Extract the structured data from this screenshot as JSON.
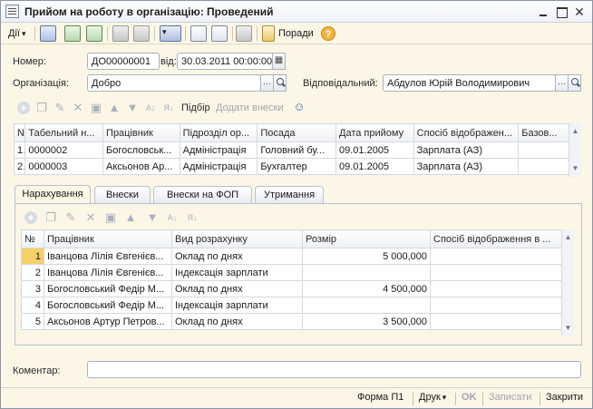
{
  "window": {
    "title": "Прийом на роботу в організацію: Проведений",
    "controls": {
      "close": "✕"
    }
  },
  "toolbar": {
    "actions_label": "Дії",
    "help_label": "Поради"
  },
  "header": {
    "number_label": "Номер:",
    "number_value": "ДО00000001",
    "date_label": "від:",
    "date_value": "30.03.2011 00:00:00",
    "org_label": "Організація:",
    "org_value": "Добро",
    "resp_label": "Відповідальний:",
    "resp_value": "Абдулов Юрій Володимирович"
  },
  "top_table_toolbar": {
    "pick_label": "Підбір",
    "add_contrib_label": "Додати внески"
  },
  "top_table": {
    "columns": [
      "N",
      "Табельний н...",
      "Працівник",
      "Підрозділ ор...",
      "Посада",
      "Дата прийому",
      "Спосіб відображен...",
      "Базов..."
    ],
    "rows": [
      [
        "1",
        "0000002",
        "Богословськ...",
        "Адміністрація",
        "Головний бу...",
        "09.01.2005",
        "Зарплата (АЗ)",
        ""
      ],
      [
        "2",
        "0000003",
        "Аксьонов Ар...",
        "Адміністрація",
        "Бухгалтер",
        "09.01.2005",
        "Зарплата (АЗ)",
        ""
      ]
    ]
  },
  "tabs": [
    {
      "label": "Нарахування"
    },
    {
      "label": "Внески"
    },
    {
      "label": "Внески на ФОП"
    },
    {
      "label": "Утримання"
    }
  ],
  "accrual_table": {
    "columns": [
      "№",
      "Працівник",
      "Вид розрахунку",
      "Розмір",
      "Спосіб відображення в ..."
    ],
    "rows": [
      [
        "1",
        "Іванцова Лілія Євгенієв...",
        "Оклад по днях",
        "5 000,000",
        ""
      ],
      [
        "2",
        "Іванцова Лілія Євгенієв...",
        "Індексація зарплати",
        "",
        ""
      ],
      [
        "3",
        "Богословський Федір М...",
        "Оклад по днях",
        "4 500,000",
        ""
      ],
      [
        "4",
        "Богословський Федір М...",
        "Індексація зарплати",
        "",
        ""
      ],
      [
        "5",
        "Аксьонов Артур Петров...",
        "Оклад по днях",
        "3 500,000",
        ""
      ]
    ]
  },
  "comment": {
    "label": "Коментар:",
    "value": ""
  },
  "footer": {
    "form_label": "Форма П1",
    "print_label": "Друк",
    "ok_label": "OK",
    "save_label": "Записати",
    "close_label": "Закрити"
  },
  "colors": {
    "accent_selected_cell": "#f6cf68",
    "background": "#fbf6e6"
  },
  "icons": [
    "window-icon",
    "new-icon",
    "copy-icon",
    "refresh-icon",
    "print-icon",
    "help-icon",
    "search-icon",
    "calendar-icon"
  ]
}
